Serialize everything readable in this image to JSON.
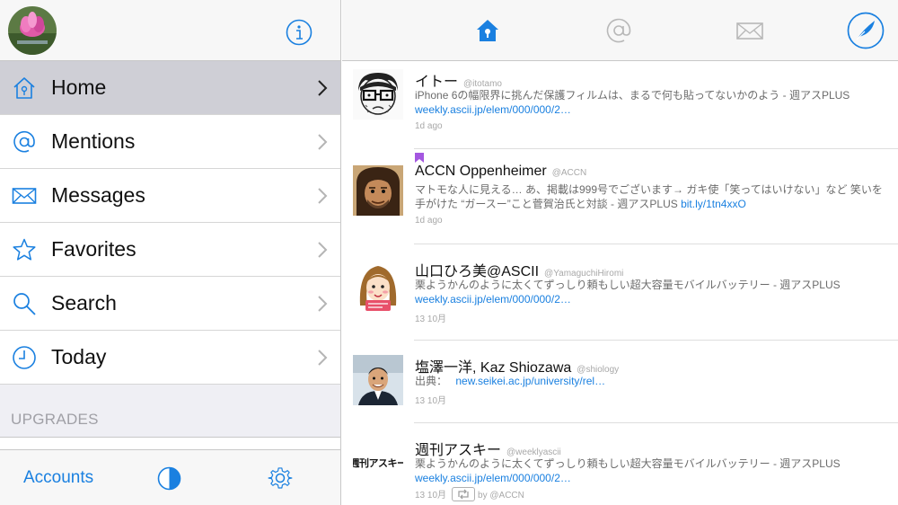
{
  "sidebar": {
    "items": [
      {
        "label": "Home"
      },
      {
        "label": "Mentions"
      },
      {
        "label": "Messages"
      },
      {
        "label": "Favorites"
      },
      {
        "label": "Search"
      },
      {
        "label": "Today"
      }
    ],
    "section_title": "UPGRADES",
    "footer": {
      "accounts_label": "Accounts"
    }
  },
  "colors": {
    "accent": "#1a80e0",
    "selected_row": "#cfcfd6",
    "bookmark": "#a457e0"
  },
  "icons": {
    "header": [
      "profile-avatar",
      "info-icon"
    ],
    "tabs": [
      "home-icon",
      "at-icon",
      "envelope-icon",
      "quill-icon"
    ],
    "footer": [
      "half-circle-icon",
      "gear-icon"
    ]
  },
  "tweets": [
    {
      "name": "イトー",
      "handle": "@itotamo",
      "text": "iPhone 6の幅限界に挑んだ保護フィルムは、まるで何も貼ってないかのよう - 週アスPLUS",
      "link": "weekly.ascii.jp/elem/000/000/2…",
      "time": "1d ago"
    },
    {
      "name": "ACCN Oppenheimer",
      "handle": "@ACCN",
      "text": "マトモな人に見える… あ、掲載は999号でございます→ ガキ使「笑ってはいけない」など 笑いを手がけた “ガースー”こと菅賀治氏と対談 - 週アスPLUS",
      "link": "bit.ly/1tn4xxO",
      "time": "1d ago"
    },
    {
      "name": "山口ひろ美@ASCII",
      "handle": "@YamaguchiHiromi",
      "text": "栗ようかんのように太くてずっしり頼もしい超大容量モバイルバッテリー - 週アスPLUS",
      "link": "weekly.ascii.jp/elem/000/000/2…",
      "time": "13 10月"
    },
    {
      "name": "塩澤一洋, Kaz Shiozawa",
      "handle": "@shiology",
      "text": "出典：",
      "link": "new.seikei.ac.jp/university/rel…",
      "time": "13 10月"
    },
    {
      "name": "週刊アスキー",
      "handle": "@weeklyascii",
      "text": "栗ようかんのように太くてずっしり頼もしい超大容量モバイルバッテリー - 週アスPLUS",
      "link": "weekly.ascii.jp/elem/000/000/2…",
      "time": "13 10月",
      "retweet_by": "by @ACCN",
      "avatar_text": "週刊アスキー"
    }
  ]
}
